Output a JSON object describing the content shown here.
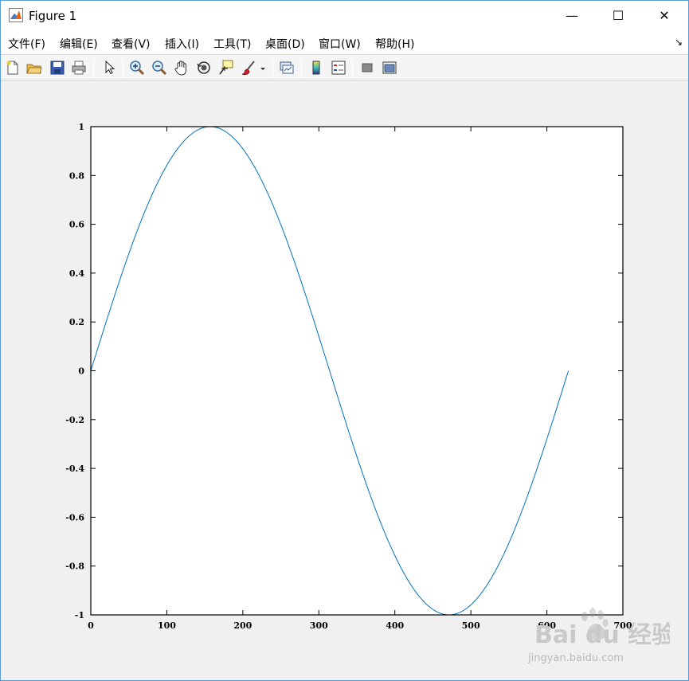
{
  "window": {
    "title": "Figure 1",
    "minimize_symbol": "—",
    "maximize_symbol": "☐",
    "close_symbol": "✕"
  },
  "menu": {
    "items": [
      {
        "label": "文件(F)"
      },
      {
        "label": "编辑(E)"
      },
      {
        "label": "查看(V)"
      },
      {
        "label": "插入(I)"
      },
      {
        "label": "工具(T)"
      },
      {
        "label": "桌面(D)"
      },
      {
        "label": "窗口(W)"
      },
      {
        "label": "帮助(H)"
      }
    ],
    "dock_arrow": "↘"
  },
  "toolbar": {
    "icons": [
      "new-figure-icon",
      "open-file-icon",
      "save-icon",
      "print-icon",
      "pointer-icon",
      "zoom-in-icon",
      "zoom-out-icon",
      "pan-hand-icon",
      "rotate-3d-icon",
      "data-cursor-icon",
      "brush-icon",
      "brush-dropdown-icon",
      "link-plot-icon",
      "colorbar-icon",
      "legend-icon",
      "hide-plot-tools-icon",
      "show-plot-tools-icon"
    ]
  },
  "watermark": {
    "brand": "Bai du 经验",
    "url": "jingyan.baidu.com"
  },
  "colors": {
    "line": "#0072bd",
    "axes": "#000000",
    "plot_bg": "#ffffff",
    "figure_bg": "#f0f0f0"
  },
  "chart_data": {
    "type": "line",
    "title": "",
    "xlabel": "",
    "ylabel": "",
    "xlim": [
      0,
      700
    ],
    "ylim": [
      -1,
      1
    ],
    "xticks": [
      "0",
      "100",
      "200",
      "300",
      "400",
      "500",
      "600",
      "700"
    ],
    "yticks": [
      "-1",
      "-0.8",
      "-0.6",
      "-0.4",
      "-0.2",
      "0",
      "0.2",
      "0.4",
      "0.6",
      "0.8",
      "1"
    ],
    "grid": false,
    "series": [
      {
        "color": "#0072bd",
        "function": "sin(x/100)",
        "x_range": [
          0,
          628.32
        ],
        "x": [
          0,
          50,
          100,
          157.08,
          200,
          250,
          300,
          314.16,
          350,
          400,
          450,
          471.24,
          500,
          550,
          600,
          628.32
        ],
        "y": [
          0,
          0.479,
          0.841,
          1,
          0.909,
          0.598,
          0.141,
          0,
          -0.351,
          -0.757,
          -0.978,
          -1,
          -0.959,
          -0.706,
          -0.279,
          0
        ]
      }
    ]
  }
}
